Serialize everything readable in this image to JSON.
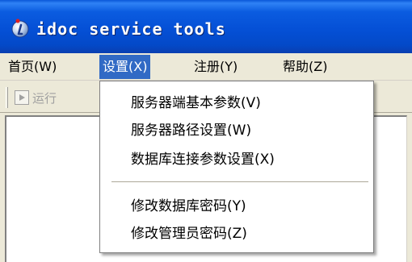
{
  "window": {
    "title": "idoc service tools"
  },
  "icons": {
    "app": "idoc-app-icon",
    "run": "run-icon"
  },
  "colors": {
    "titlebar": "#0550D6",
    "menu_highlight": "#316AC5"
  },
  "menubar": {
    "items": [
      {
        "label": "首页(W)"
      },
      {
        "label": "设置(X)"
      },
      {
        "label": "注册(Y)"
      },
      {
        "label": "帮助(Z)"
      }
    ],
    "active_index": 1
  },
  "toolbar": {
    "run_label": "运行"
  },
  "dropdown": {
    "items": [
      {
        "label": "服务器端基本参数(V)"
      },
      {
        "label": "服务器路径设置(W)"
      },
      {
        "label": "数据库连接参数设置(X)"
      },
      {
        "label": "修改数据库密码(Y)"
      },
      {
        "label": "修改管理员密码(Z)"
      }
    ]
  }
}
